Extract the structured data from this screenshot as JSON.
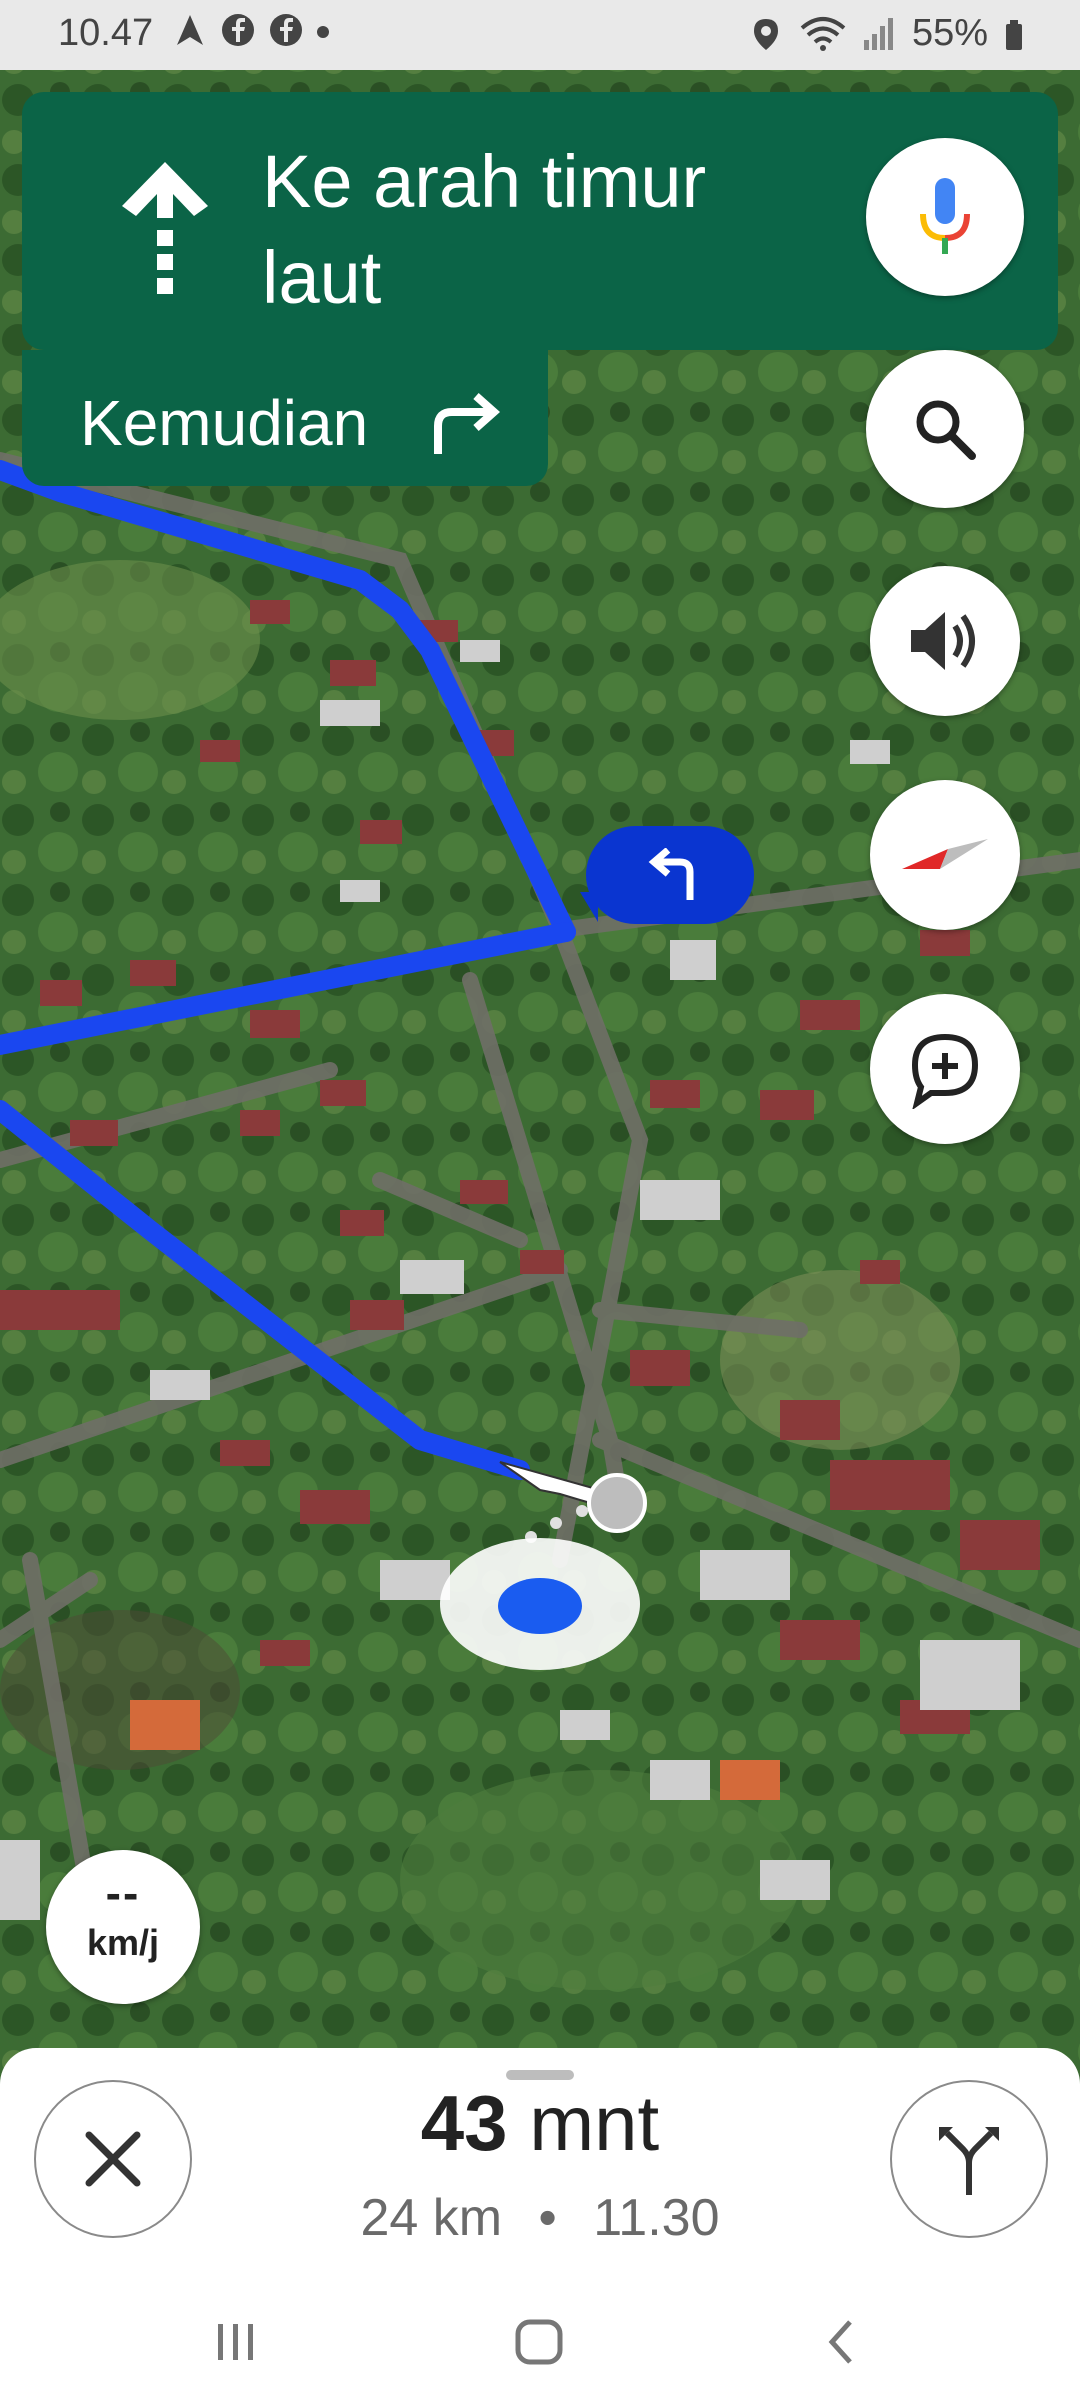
{
  "status_bar": {
    "time": "10.47",
    "battery": "55%",
    "left_icons": [
      "navigation-icon",
      "facebook-icon",
      "facebook-icon",
      "dot-icon"
    ],
    "right_icons": [
      "location-icon",
      "wifi-icon",
      "signal-icon",
      "battery-icon"
    ]
  },
  "navigation": {
    "instruction": "Ke arah timur laut",
    "maneuver_icon": "straight-arrow-icon",
    "then_label": "Kemudian",
    "then_icon": "turn-right-icon"
  },
  "map": {
    "turn_callout_icon": "turn-left-icon",
    "route_color": "#1a47f0"
  },
  "fab_buttons": [
    "microphone-icon",
    "search-icon",
    "volume-icon",
    "compass-icon",
    "add-report-icon"
  ],
  "speed": {
    "value": "--",
    "unit": "km/j"
  },
  "trip": {
    "duration_value": "43",
    "duration_unit": "mnt",
    "distance": "24 km",
    "separator": "•",
    "arrival": "11.30"
  },
  "colors": {
    "nav_green": "#0b6447",
    "route_blue": "#1a47f0"
  }
}
